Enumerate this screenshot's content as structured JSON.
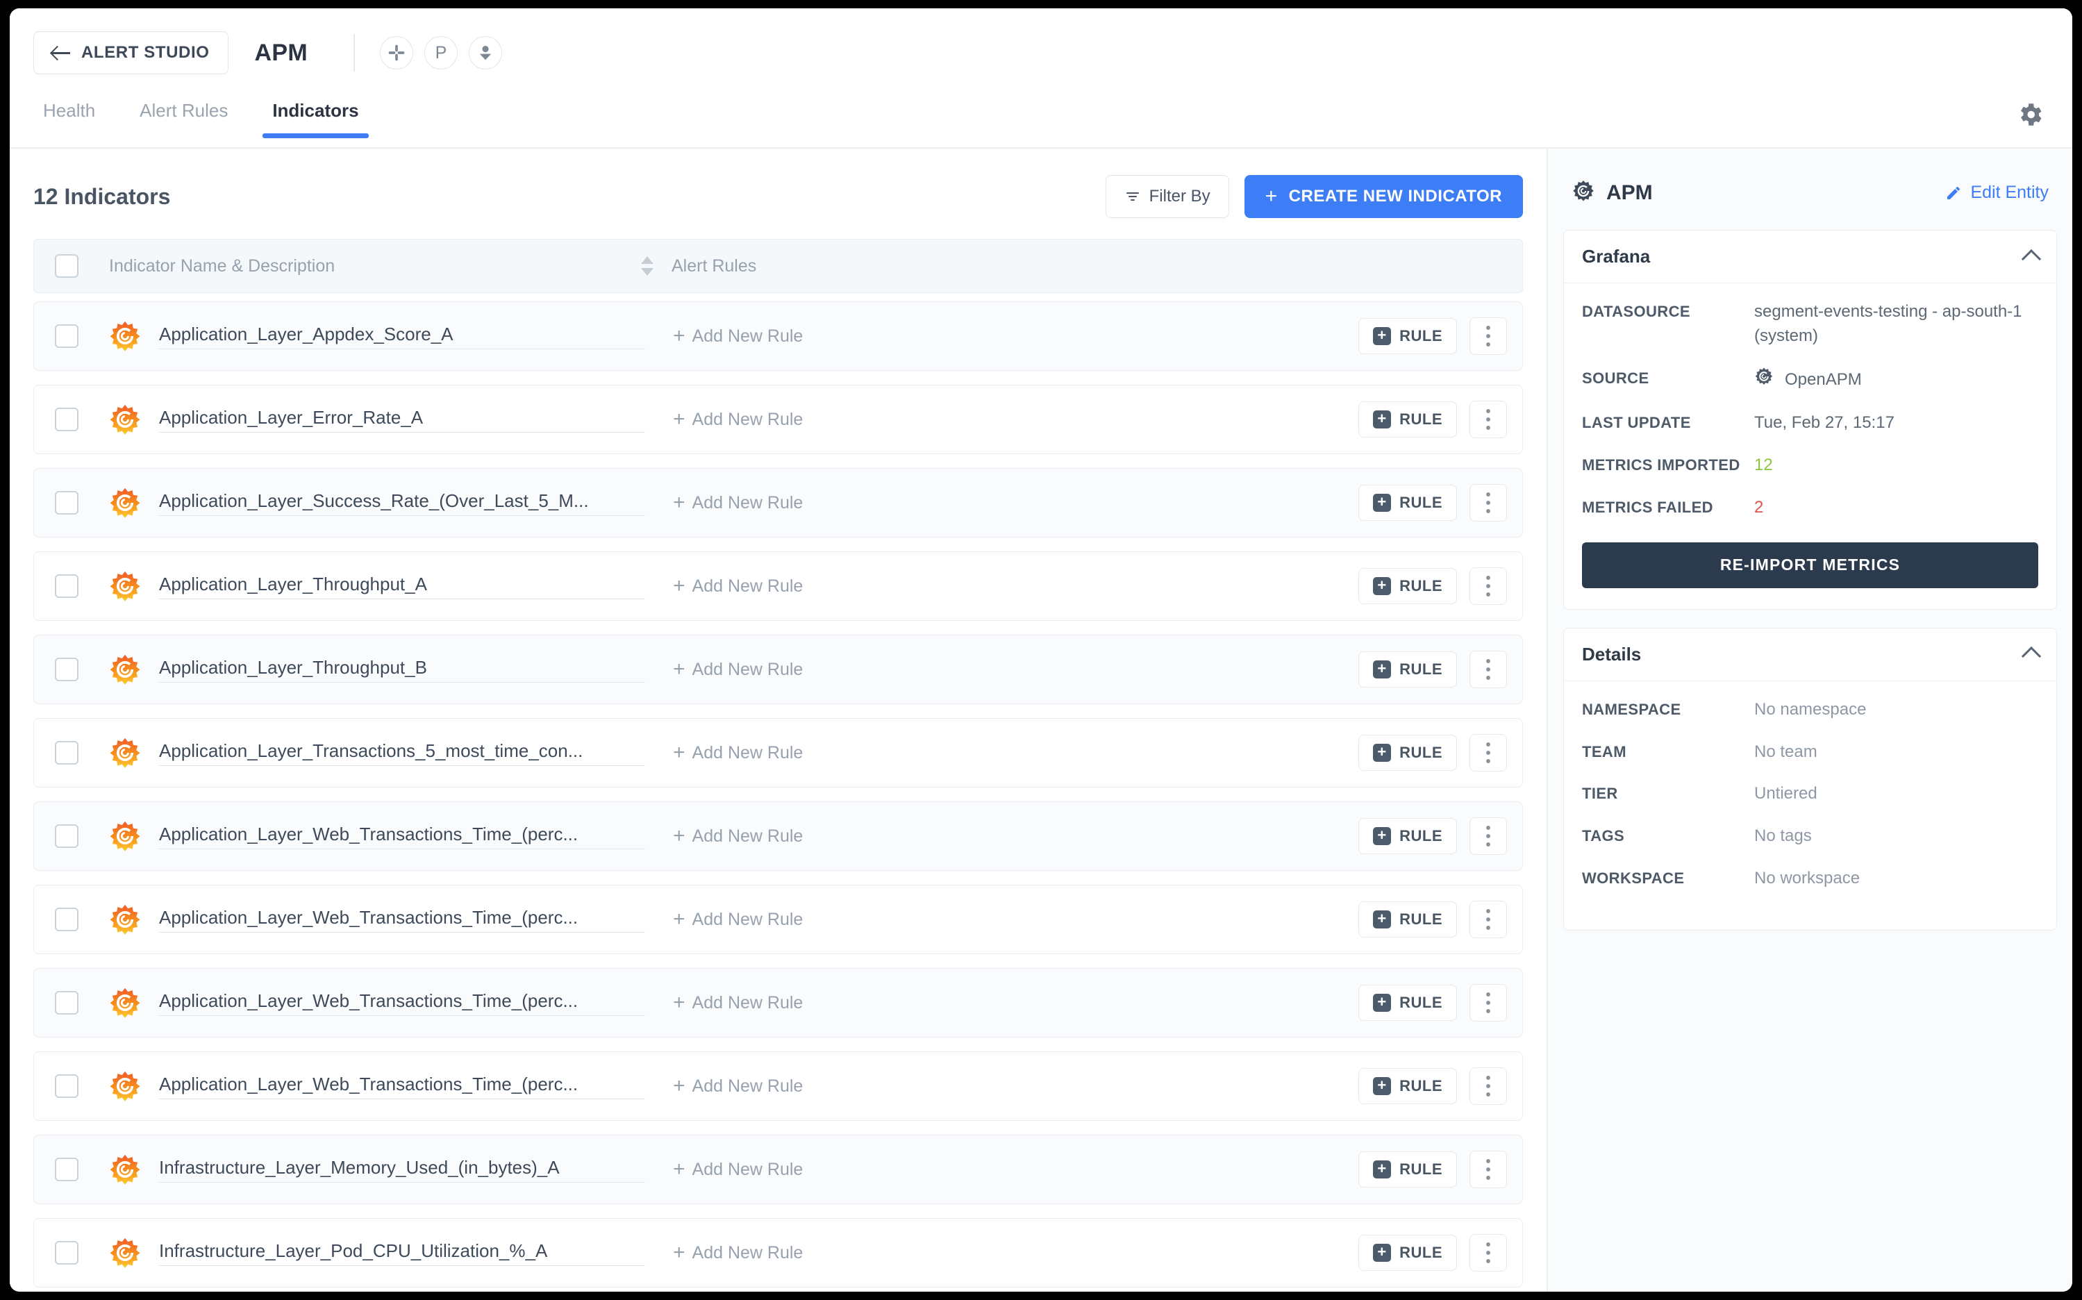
{
  "topbar": {
    "back_label": "ALERT STUDIO",
    "app_title": "APM",
    "icons": [
      "slack-icon",
      "pagerduty-icon",
      "user-download-icon"
    ],
    "settings_icon": "gear-icon"
  },
  "tabs": [
    {
      "label": "Health",
      "active": false
    },
    {
      "label": "Alert Rules",
      "active": false
    },
    {
      "label": "Indicators",
      "active": true
    }
  ],
  "list": {
    "title": "12 Indicators",
    "filter_label": "Filter By",
    "create_label": "CREATE NEW INDICATOR",
    "create_plus": "+",
    "columns": {
      "name": "Indicator Name & Description",
      "rules": "Alert Rules"
    },
    "add_rule_label": "Add New Rule",
    "add_rule_plus": "+",
    "rule_button_label": "RULE",
    "rows": [
      {
        "name": "Application_Layer_Appdex_Score_A"
      },
      {
        "name": "Application_Layer_Error_Rate_A"
      },
      {
        "name": "Application_Layer_Success_Rate_(Over_Last_5_M..."
      },
      {
        "name": "Application_Layer_Throughput_A"
      },
      {
        "name": "Application_Layer_Throughput_B"
      },
      {
        "name": "Application_Layer_Transactions_5_most_time_con..."
      },
      {
        "name": "Application_Layer_Web_Transactions_Time_(perc..."
      },
      {
        "name": "Application_Layer_Web_Transactions_Time_(perc..."
      },
      {
        "name": "Application_Layer_Web_Transactions_Time_(perc..."
      },
      {
        "name": "Application_Layer_Web_Transactions_Time_(perc..."
      },
      {
        "name": "Infrastructure_Layer_Memory_Used_(in_bytes)_A"
      },
      {
        "name": "Infrastructure_Layer_Pod_CPU_Utilization_%_A"
      }
    ]
  },
  "entity": {
    "title": "APM",
    "edit_label": "Edit Entity",
    "grafana": {
      "heading": "Grafana",
      "datasource_label": "DATASOURCE",
      "datasource_value": "segment-events-testing - ap-south-1 (system)",
      "source_label": "SOURCE",
      "source_value": "OpenAPM",
      "last_update_label": "LAST UPDATE",
      "last_update_value": "Tue, Feb 27, 15:17",
      "metrics_imported_label": "METRICS IMPORTED",
      "metrics_imported_value": "12",
      "metrics_failed_label": "METRICS FAILED",
      "metrics_failed_value": "2",
      "reimport_label": "RE-IMPORT METRICS"
    },
    "details": {
      "heading": "Details",
      "items": [
        {
          "label": "NAMESPACE",
          "value": "No namespace"
        },
        {
          "label": "TEAM",
          "value": "No team"
        },
        {
          "label": "TIER",
          "value": "Untiered"
        },
        {
          "label": "TAGS",
          "value": "No tags"
        },
        {
          "label": "WORKSPACE",
          "value": "No workspace"
        }
      ]
    }
  },
  "colors": {
    "accent": "#3d7df6",
    "dark_button": "#2c3a4d",
    "success": "#8bc53f",
    "danger": "#e0554a",
    "grafana_orange": "#f05a28"
  }
}
